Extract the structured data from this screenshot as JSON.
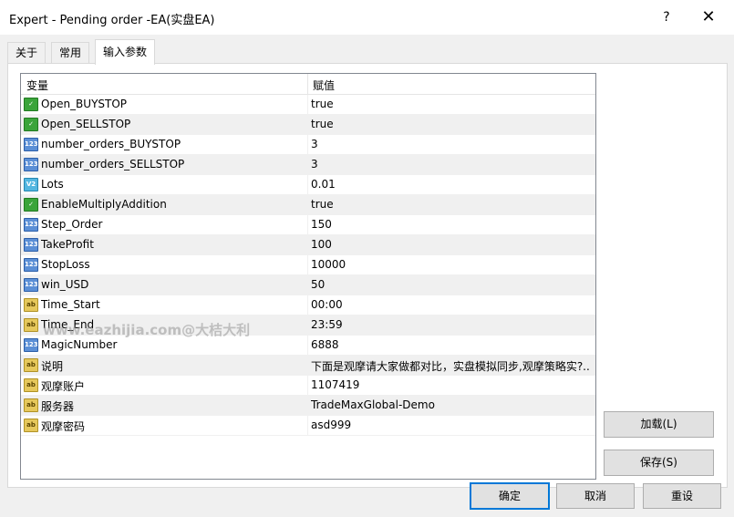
{
  "window": {
    "title": "Expert - Pending order -EA(实盘EA)",
    "help": "?",
    "close": "✕"
  },
  "tabs": [
    {
      "label": "关于"
    },
    {
      "label": "常用"
    },
    {
      "label": "输入参数"
    }
  ],
  "grid": {
    "col_variable": "变量",
    "col_value": "赋值",
    "rows": [
      {
        "type": "bool",
        "icon": "boolean-icon",
        "name": "Open_BUYSTOP",
        "value": "true"
      },
      {
        "type": "bool",
        "icon": "boolean-icon",
        "name": "Open_SELLSTOP",
        "value": "true"
      },
      {
        "type": "int",
        "icon": "integer-icon",
        "name": "number_orders_BUYSTOP",
        "value": "3"
      },
      {
        "type": "int",
        "icon": "integer-icon",
        "name": "number_orders_SELLSTOP",
        "value": "3"
      },
      {
        "type": "dbl",
        "icon": "double-icon",
        "name": "Lots",
        "value": "0.01"
      },
      {
        "type": "bool",
        "icon": "boolean-icon",
        "name": "EnableMultiplyAddition",
        "value": "true"
      },
      {
        "type": "int",
        "icon": "integer-icon",
        "name": "Step_Order",
        "value": "150"
      },
      {
        "type": "int",
        "icon": "integer-icon",
        "name": "TakeProfit",
        "value": "100"
      },
      {
        "type": "int",
        "icon": "integer-icon",
        "name": "StopLoss",
        "value": "10000"
      },
      {
        "type": "int",
        "icon": "integer-icon",
        "name": "win_USD",
        "value": "50"
      },
      {
        "type": "str",
        "icon": "string-icon",
        "name": "Time_Start",
        "value": "00:00"
      },
      {
        "type": "str",
        "icon": "string-icon",
        "name": "Time_End",
        "value": "23:59"
      },
      {
        "type": "int",
        "icon": "integer-icon",
        "name": "MagicNumber",
        "value": "6888"
      },
      {
        "type": "str",
        "icon": "string-icon",
        "name": "说明",
        "value": "下面是观摩请大家做都对比，实盘模拟同步,观摩策略实?.."
      },
      {
        "type": "str",
        "icon": "string-icon",
        "name": "观摩账户",
        "value": "1107419"
      },
      {
        "type": "str",
        "icon": "string-icon",
        "name": "服务器",
        "value": "TradeMaxGlobal-Demo"
      },
      {
        "type": "str",
        "icon": "string-icon",
        "name": "观摩密码",
        "value": "asd999"
      }
    ]
  },
  "icon_text": {
    "bool": "✓",
    "int": "123",
    "dbl": "V2",
    "str": "ab"
  },
  "watermark": "www.eazhijia.com@大桔大利",
  "buttons": {
    "load": "加载(L)",
    "save": "保存(S)",
    "ok": "确定",
    "cancel": "取消",
    "reset": "重设"
  }
}
